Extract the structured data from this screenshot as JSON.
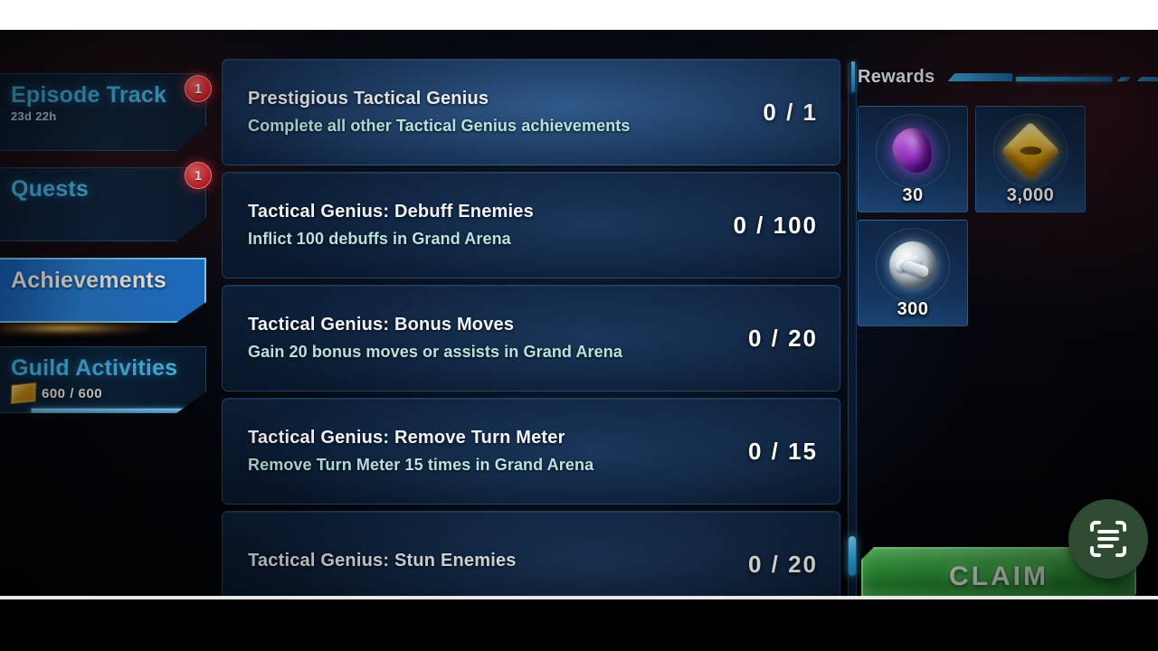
{
  "sidebar": {
    "items": [
      {
        "id": "episode-track",
        "label": "Episode Track",
        "subtitle": "23d 22h",
        "badge": "1",
        "active": false
      },
      {
        "id": "quests",
        "label": "Quests",
        "subtitle": "",
        "badge": "1",
        "active": false
      },
      {
        "id": "achievements",
        "label": "Achievements",
        "subtitle": "",
        "badge": "",
        "active": true
      },
      {
        "id": "guild-activities",
        "label": "Guild Activities",
        "subtitle": "",
        "badge": "",
        "active": false
      }
    ],
    "guild_progress": {
      "value": 600,
      "max": 600,
      "text": "600 / 600",
      "icon": "guild-ticket-icon"
    }
  },
  "achievements": {
    "rows": [
      {
        "title": "Prestigious Tactical Genius",
        "description": "Complete all other Tactical Genius achievements",
        "progress": "0 / 1",
        "current": 0,
        "target": 1,
        "highlighted": true
      },
      {
        "title": "Tactical Genius: Debuff Enemies",
        "description": "Inflict 100 debuffs in Grand Arena",
        "progress": "0 / 100",
        "current": 0,
        "target": 100,
        "highlighted": false
      },
      {
        "title": "Tactical Genius: Bonus Moves",
        "description": "Gain 20 bonus moves or assists in Grand Arena",
        "progress": "0 / 20",
        "current": 0,
        "target": 20,
        "highlighted": false
      },
      {
        "title": "Tactical Genius: Remove Turn Meter",
        "description": "Remove Turn Meter 15 times in Grand Arena",
        "progress": "0 / 15",
        "current": 0,
        "target": 15,
        "highlighted": false
      },
      {
        "title": "Tactical Genius: Stun Enemies",
        "description": "",
        "progress": "0 / 20",
        "current": 0,
        "target": 20,
        "highlighted": false
      }
    ]
  },
  "rewards": {
    "title": "Rewards",
    "items": [
      {
        "id": "crystals",
        "icon": "purple-crystal-icon",
        "quantity": "30"
      },
      {
        "id": "credits",
        "icon": "gold-credit-icon",
        "quantity": "3,000"
      },
      {
        "id": "ally-points",
        "icon": "silver-handshake-icon",
        "quantity": "300"
      }
    ],
    "claim_label": "CLAIM"
  },
  "overlay": {
    "fab_icon": "scan-text-icon"
  },
  "colors": {
    "accent_blue": "#4fc3f7",
    "active_tab": "#2b86df",
    "claim_green": "#34ad3f",
    "badge_red": "#d01f2a",
    "description_teal": "#b6e3de"
  }
}
